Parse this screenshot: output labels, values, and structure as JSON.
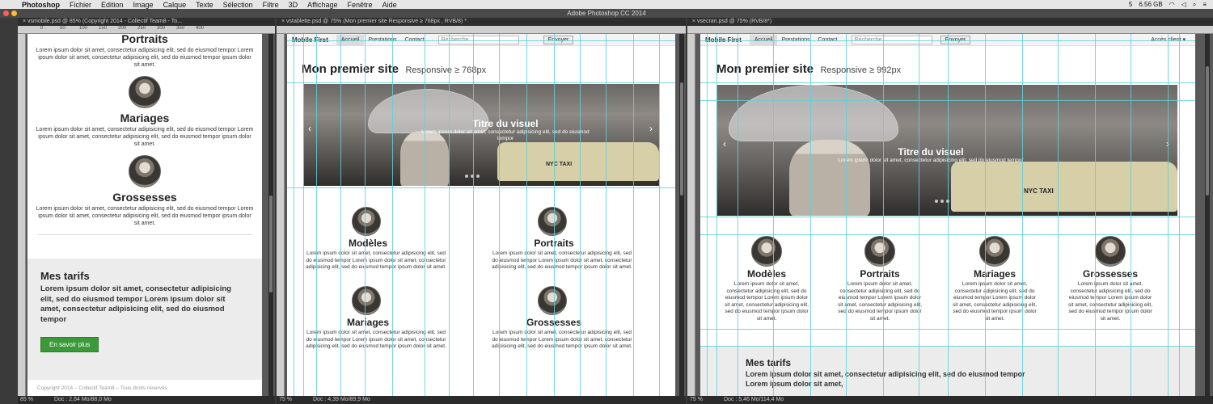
{
  "menubar": {
    "app": "Photoshop",
    "items": [
      "Fichier",
      "Edition",
      "Image",
      "Calque",
      "Texte",
      "Sélection",
      "Filtre",
      "3D",
      "Affichage",
      "Fenêtre",
      "Aide"
    ],
    "memory": "6.56 GB",
    "badge": "5"
  },
  "window_title": "Adobe Photoshop CC 2014",
  "docs": [
    {
      "tab": "vsmobile.psd @ 85% (Copyright 2014 - Collectif Team8 - To...",
      "zoom": "85 %",
      "status": "Doc : 2,64 Mo/88,0 Mo"
    },
    {
      "tab": "vstablette.psd @ 75% (Mon premier site Responsive ≥ 768px , RVB/8) *",
      "zoom": "75 %",
      "status": "Doc : 4,39 Mo/89,9 Mo"
    },
    {
      "tab": "vsecran.psd @ 75% (RVB/8*)",
      "zoom": "75 %",
      "status": "Doc : 5,46 Mo/114,4 Mo"
    }
  ],
  "ruler_ticks": [
    "0",
    "50",
    "100",
    "150",
    "200",
    "250",
    "300",
    "350",
    "400"
  ],
  "site": {
    "brand": "Mobile First",
    "nav_active": "Accueil",
    "nav_links": [
      "Prestations",
      "Contact"
    ],
    "search_placeholder": "Recherche...",
    "send": "Envoyer",
    "client": "Accès client ▾",
    "title": "Mon premier site",
    "tablet_sub": "Responsive ≥ 768px",
    "desktop_sub": "Responsive ≥ 992px",
    "hero_title": "Titre du visuel",
    "hero_text": "Lorem ipsum dolor sit amet, consectetur adipisicing elit, sed do eiusmod tempor",
    "taxi": "NYC TAXI",
    "sections": [
      "Modèles",
      "Portraits",
      "Mariages",
      "Grossesses"
    ],
    "lorem_short": "Lorem ipsum dolor sit amet, consectetur adipisicing elit, sed do eiusmod tempor Lorem ipsum dolor sit amet, consectetur adipisicing elit, sed do eiusmod tempor ipsum dolor sit amet.",
    "tarifs_title": "Mes tarifs",
    "tarifs_text": "Lorem ipsum dolor sit amet, consectetur adipisicing elit, sed do eiusmod tempor Lorem ipsum dolor sit amet, consectetur adipisicing elit, sed do eiusmod tempor",
    "tarifs_desktop": "Lorem ipsum dolor sit amet, consectetur adipisicing elit, sed do eiusmod tempor Lorem ipsum dolor sit amet,",
    "cta": "En savoir plus",
    "copyright": "Copyright 2014 – Collectif Team8 – Tous droits réservés"
  }
}
